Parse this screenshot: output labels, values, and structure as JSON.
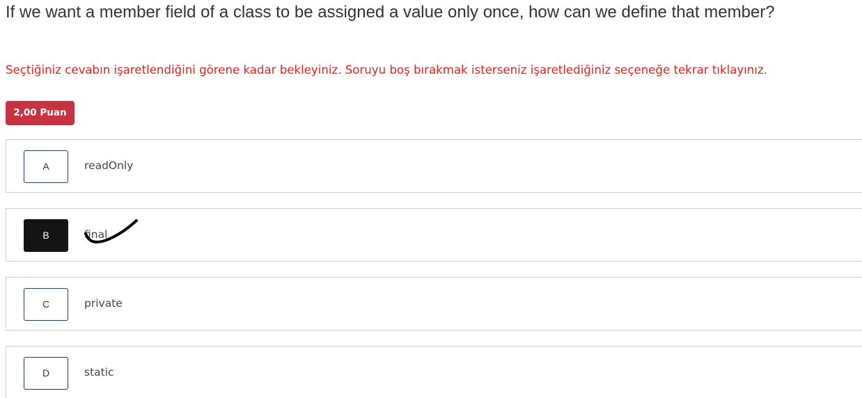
{
  "question": {
    "text": "If we want a member field of a class to be assigned a value only once, how can we define that member?"
  },
  "instruction": {
    "text": "Seçtiğiniz cevabın işaretlendiğini görene kadar bekleyiniz. Soruyu boş bırakmak isterseniz işaretlediğiniz seçeneğe tekrar tıklayınız."
  },
  "points": {
    "label": "2,00 Puan"
  },
  "options": [
    {
      "letter": "A",
      "text": "readOnly",
      "selected": false
    },
    {
      "letter": "B",
      "text": "final",
      "selected": true
    },
    {
      "letter": "C",
      "text": "private",
      "selected": false
    },
    {
      "letter": "D",
      "text": "static",
      "selected": false
    }
  ],
  "colors": {
    "instruction": "#e8211d",
    "badge": "#c83344",
    "selected_letter_bg": "#141416",
    "option_border": "#cfcfcf",
    "letter_border": "#1e3a5f"
  },
  "icons": {
    "selection_mark": "checkmark-icon"
  }
}
